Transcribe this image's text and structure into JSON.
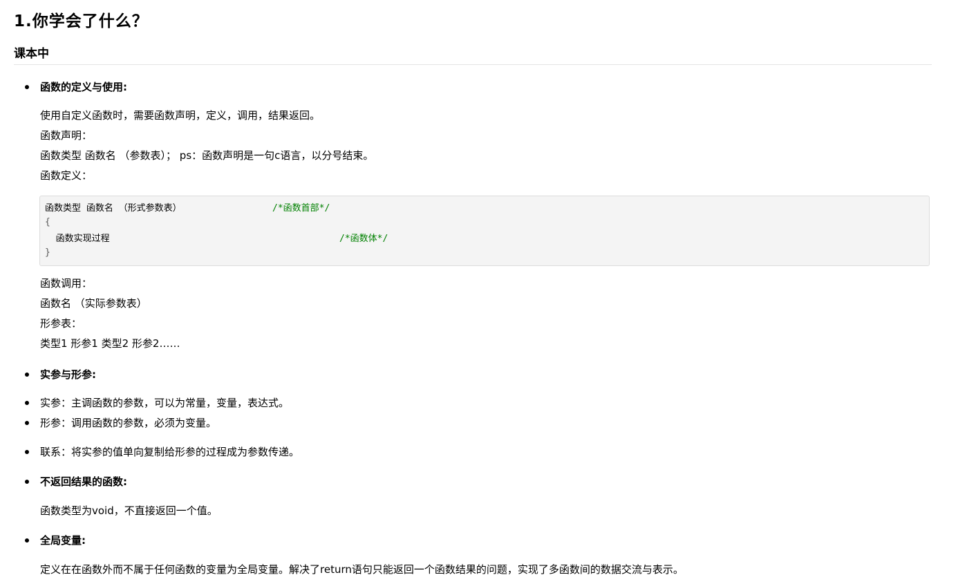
{
  "heading": {
    "number": "1.",
    "title": "你学会了什么？"
  },
  "subheading": "课本中",
  "section_function": {
    "title": "函数的定义与使用:",
    "lines": [
      "使用自定义函数时，需要函数声明，定义，调用，结果返回。",
      "函数声明：",
      "函数类型 函数名 （参数表）； ps：函数声明是一句c语言，以分号结束。",
      "函数定义："
    ],
    "code": {
      "line1": "函数类型 函数名 （形式参数表）",
      "line1_comment": "/*函数首部*/",
      "line2": "{",
      "line3": "  函数实现过程",
      "line3_comment": "/*函数体*/",
      "line4": "}"
    },
    "lines_after": [
      "函数调用：",
      "函数名 （实际参数表）",
      "形参表：",
      "类型1 形参1 类型2 形参2……"
    ]
  },
  "section_params": {
    "title": "实参与形参:",
    "items": [
      "实参：主调函数的参数，可以为常量，变量，表达式。",
      "形参：调用函数的参数，必须为变量。"
    ],
    "relation": "联系：将实参的值单向复制给形参的过程成为参数传递。"
  },
  "section_void": {
    "title": "不返回结果的函数:",
    "text": "函数类型为void，不直接返回一个值。"
  },
  "section_global": {
    "title": "全局变量:",
    "text": "定义在在函数外而不属于任何函数的变量为全局变量。解决了return语句只能返回一个函数结果的问题，实现了多函数间的数据交流与表示。"
  }
}
